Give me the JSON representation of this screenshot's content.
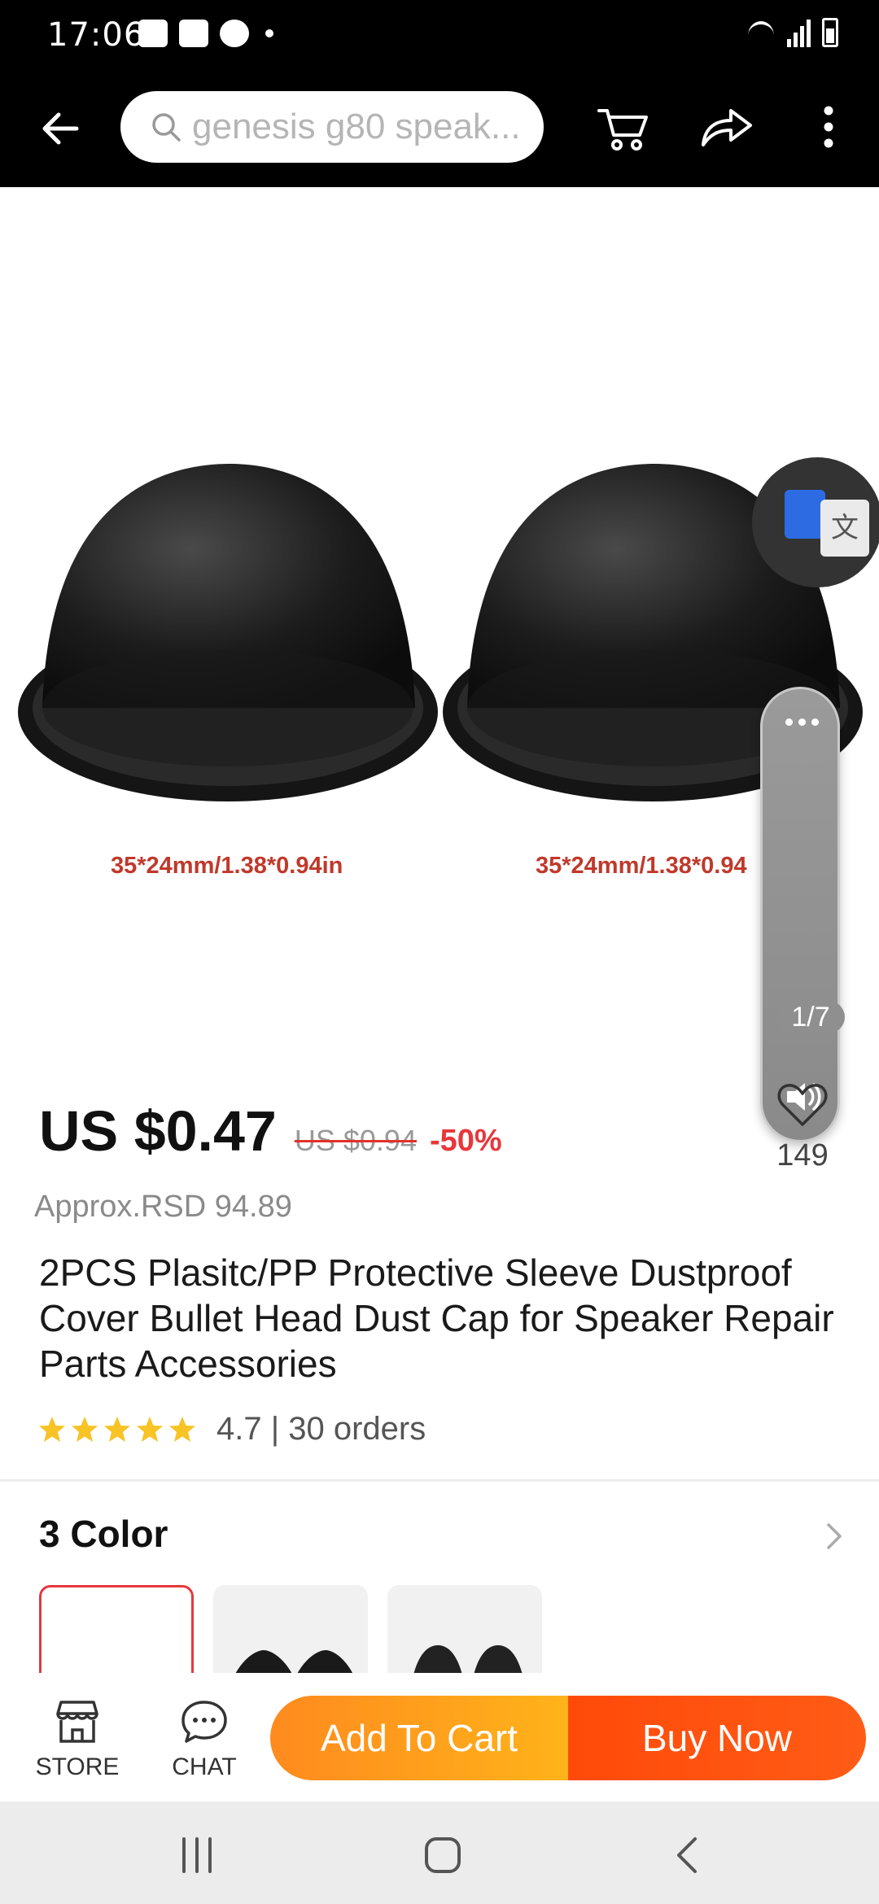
{
  "status_bar": {
    "time": "17:06",
    "left_icons": [
      "emoji-notification-icon",
      "gallery-notification-icon",
      "facebook-notification-icon",
      "more-notifications-dot"
    ],
    "right_icons": [
      "wifi-icon",
      "signal-icon",
      "battery-icon"
    ]
  },
  "header": {
    "search_text": "genesis g80 speak...",
    "icons": [
      "back-arrow-icon",
      "search-icon",
      "cart-icon",
      "share-icon",
      "more-vertical-icon"
    ]
  },
  "gallery": {
    "dimension_label_1": "35*24mm/1.38*0.94in",
    "dimension_label_2": "35*24mm/1.38*0.94",
    "page_indicator": "1/7",
    "overlay_icons": [
      "translate-icon",
      "volume-icon"
    ]
  },
  "product": {
    "price": "US $0.47",
    "original_price": "US $0.94",
    "discount": "-50%",
    "approx_price": "Approx.RSD 94.89",
    "wishlist_count": "149",
    "title": "2PCS Plasitc/PP Protective Sleeve Dustproof Cover Bullet Head Dust Cap for Speaker Repair Parts Accessories",
    "rating_text": "4.7 | 30 orders",
    "rating_stars": 5
  },
  "variants": {
    "title": "3 Color",
    "count": 3,
    "selected_index": 0
  },
  "action_bar": {
    "store_label": "STORE",
    "chat_label": "CHAT",
    "add_to_cart_label": "Add To Cart",
    "buy_now_label": "Buy Now"
  },
  "colors": {
    "accent_red": "#e8373c",
    "cart_orange": "#ff9a1e",
    "buy_orange": "#ff4a0a",
    "star_yellow": "#f7c325"
  }
}
